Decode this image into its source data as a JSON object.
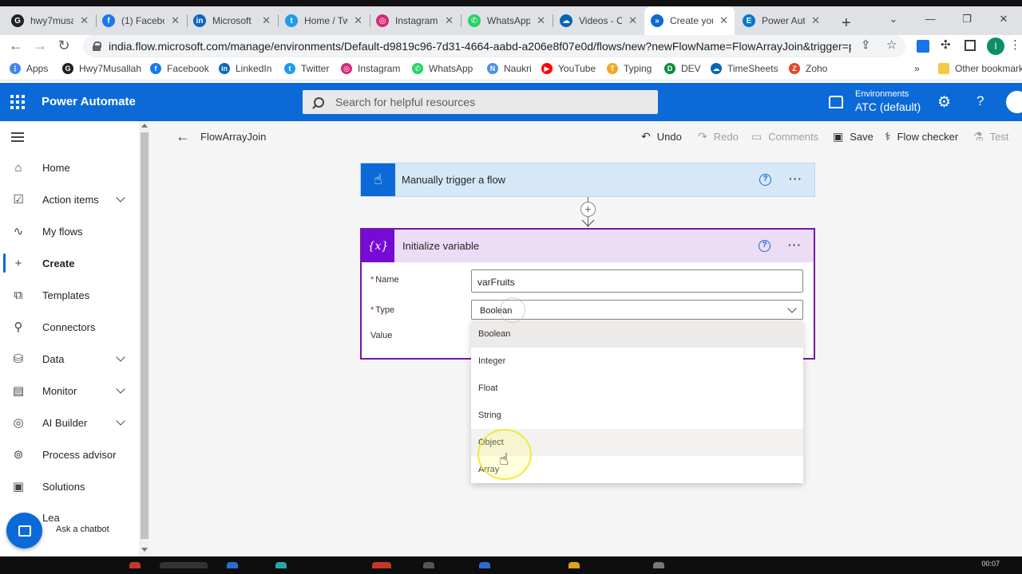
{
  "browser": {
    "tabs": [
      {
        "label": "hwy7musa",
        "favcolor": "#202124",
        "fav": "G"
      },
      {
        "label": "(1) Facebo",
        "favcolor": "#1877f2",
        "fav": "f"
      },
      {
        "label": "Microsoft",
        "favcolor": "#0a66c2",
        "fav": "in"
      },
      {
        "label": "Home / Tw",
        "favcolor": "#1d9bf0",
        "fav": "t"
      },
      {
        "label": "Instagram",
        "favcolor": "#d62976",
        "fav": "◎"
      },
      {
        "label": "WhatsApp",
        "favcolor": "#25d366",
        "fav": "✆"
      },
      {
        "label": "Videos - O",
        "favcolor": "#0364b8",
        "fav": "☁"
      },
      {
        "label": "Create you",
        "favcolor": "#0b6ad8",
        "fav": "»"
      },
      {
        "label": "Power Aut",
        "favcolor": "#0078d4",
        "fav": "E"
      }
    ],
    "new_tab": "+",
    "window_controls": [
      "⌄",
      "—",
      "❐",
      "✕"
    ],
    "url": "india.flow.microsoft.com/manage/environments/Default-d9819c96-7d31-4664-aabd-a206e8f07e0d/flows/new?newFlowName=FlowArrayJoin&trigger=provi...",
    "bookmarks": [
      {
        "label": "Apps",
        "color": "#4285f4",
        "ico": "⋮"
      },
      {
        "label": "Hwy7Musallah",
        "color": "#202124",
        "ico": "G"
      },
      {
        "label": "Facebook",
        "color": "#1877f2",
        "ico": "f"
      },
      {
        "label": "LinkedIn",
        "color": "#0a66c2",
        "ico": "in"
      },
      {
        "label": "Twitter",
        "color": "#1d9bf0",
        "ico": "t"
      },
      {
        "label": "Instagram",
        "color": "#d62976",
        "ico": "◎"
      },
      {
        "label": "WhatsApp",
        "color": "#25d366",
        "ico": "✆"
      },
      {
        "label": "Naukri",
        "color": "#4a90e2",
        "ico": "N"
      },
      {
        "label": "YouTube",
        "color": "#ff0000",
        "ico": "▶"
      },
      {
        "label": "Typing",
        "color": "#f5a623",
        "ico": "T"
      },
      {
        "label": "DEV",
        "color": "#0b8f3c",
        "ico": "D"
      },
      {
        "label": "TimeSheets",
        "color": "#0364b8",
        "ico": "☁"
      },
      {
        "label": "Zoho",
        "color": "#e6452c",
        "ico": "Z"
      }
    ],
    "bookmarks_more": "»",
    "other_bookmarks": "Other bookmarks"
  },
  "header": {
    "brand": "Power Automate",
    "search_placeholder": "Search for helpful resources",
    "environments_label": "Environments",
    "environment_name": "ATC (default)"
  },
  "nav": {
    "items": [
      {
        "label": "Home",
        "icon": "⌂",
        "chevron": false,
        "active": false
      },
      {
        "label": "Action items",
        "icon": "☑",
        "chevron": true,
        "active": false
      },
      {
        "label": "My flows",
        "icon": "∿",
        "chevron": false,
        "active": false
      },
      {
        "label": "Create",
        "icon": "+",
        "chevron": false,
        "active": true
      },
      {
        "label": "Templates",
        "icon": "⧉",
        "chevron": false,
        "active": false
      },
      {
        "label": "Connectors",
        "icon": "⚲",
        "chevron": false,
        "active": false
      },
      {
        "label": "Data",
        "icon": "⛁",
        "chevron": true,
        "active": false
      },
      {
        "label": "Monitor",
        "icon": "▤",
        "chevron": true,
        "active": false
      },
      {
        "label": "AI Builder",
        "icon": "◎",
        "chevron": true,
        "active": false
      },
      {
        "label": "Process advisor",
        "icon": "⊚",
        "chevron": false,
        "active": false
      },
      {
        "label": "Solutions",
        "icon": "▣",
        "chevron": false,
        "active": false
      }
    ],
    "partial_item": "Lea",
    "chatbot_label": "Ask a chatbot"
  },
  "commandbar": {
    "flow_name": "FlowArrayJoin",
    "undo": "Undo",
    "redo": "Redo",
    "comments": "Comments",
    "save": "Save",
    "flow_checker": "Flow checker",
    "test": "Test"
  },
  "trigger_card": {
    "title": "Manually trigger a flow",
    "help": "?",
    "more": "···"
  },
  "init_card": {
    "title": "Initialize variable",
    "icon_text": "{x}",
    "help": "?",
    "more": "···",
    "name_label": "Name",
    "name_value": "varFruits",
    "type_label": "Type",
    "type_value": "Boolean",
    "value_label": "Value",
    "required_mark": "*"
  },
  "type_dropdown": {
    "options": [
      "Boolean",
      "Integer",
      "Float",
      "String",
      "Object",
      "Array"
    ],
    "selected": "Boolean",
    "hovered": "Object"
  },
  "taskbar": {
    "time": "00:07"
  }
}
